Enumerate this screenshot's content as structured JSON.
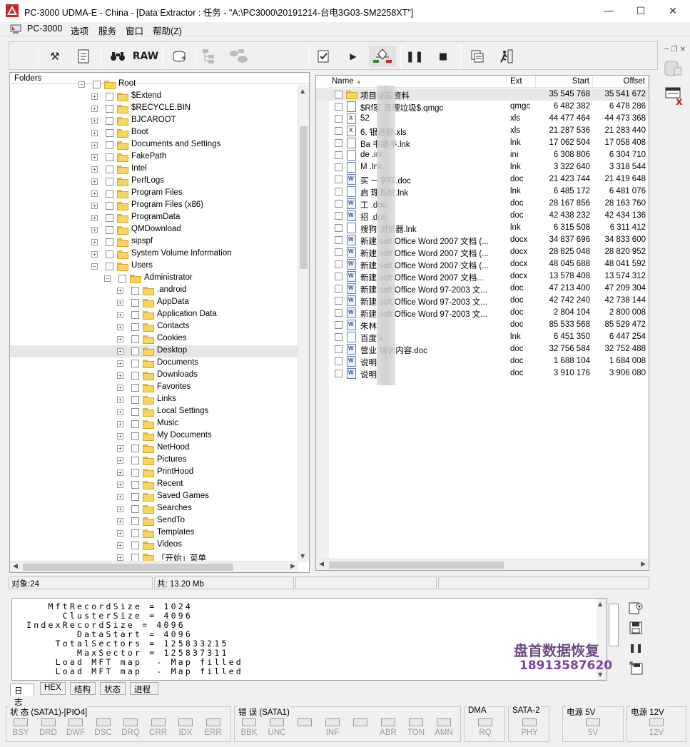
{
  "window": {
    "title": "PC-3000 UDMA-E - China - [Data Extractor : 任务 - \"A:\\PC3000\\20191214-台电3G03-SM2258XT\"]",
    "minimize": "—",
    "maximize": "☐",
    "close": "✕"
  },
  "menu": {
    "items": [
      "PC-3000",
      "选项",
      "服务",
      "窗口",
      "帮助(Z)"
    ],
    "mdi": "─ ❐ ✕"
  },
  "toolbar": {
    "raw_label": "RAW"
  },
  "folders": {
    "header": "Folders",
    "rows": [
      {
        "label": "Root",
        "level": 0,
        "exp": "−"
      },
      {
        "label": "$Extend",
        "level": 1,
        "exp": "+"
      },
      {
        "label": "$RECYCLE.BIN",
        "level": 1,
        "exp": "+"
      },
      {
        "label": "BJCAROOT",
        "level": 1,
        "exp": "+"
      },
      {
        "label": "Boot",
        "level": 1,
        "exp": "+"
      },
      {
        "label": "Documents and Settings",
        "level": 1,
        "exp": "+"
      },
      {
        "label": "FakePath",
        "level": 1,
        "exp": "+"
      },
      {
        "label": "Intel",
        "level": 1,
        "exp": "+"
      },
      {
        "label": "PerfLogs",
        "level": 1,
        "exp": "+"
      },
      {
        "label": "Program Files",
        "level": 1,
        "exp": "+"
      },
      {
        "label": "Program Files (x86)",
        "level": 1,
        "exp": "+"
      },
      {
        "label": "ProgramData",
        "level": 1,
        "exp": "+"
      },
      {
        "label": "QMDownload",
        "level": 1,
        "exp": "+"
      },
      {
        "label": "sipspf",
        "level": 1,
        "exp": "+"
      },
      {
        "label": "System Volume Information",
        "level": 1,
        "exp": "+"
      },
      {
        "label": "Users",
        "level": 1,
        "exp": "−"
      },
      {
        "label": "Administrator",
        "level": 2,
        "exp": "−"
      },
      {
        "label": ".android",
        "level": 3,
        "exp": "+"
      },
      {
        "label": "AppData",
        "level": 3,
        "exp": "+"
      },
      {
        "label": "Application Data",
        "level": 3,
        "exp": "+"
      },
      {
        "label": "Contacts",
        "level": 3,
        "exp": "+"
      },
      {
        "label": "Cookies",
        "level": 3,
        "exp": "+"
      },
      {
        "label": "Desktop",
        "level": 3,
        "exp": "+",
        "selected": true
      },
      {
        "label": "Documents",
        "level": 3,
        "exp": "+"
      },
      {
        "label": "Downloads",
        "level": 3,
        "exp": "+"
      },
      {
        "label": "Favorites",
        "level": 3,
        "exp": "+"
      },
      {
        "label": "Links",
        "level": 3,
        "exp": "+"
      },
      {
        "label": "Local Settings",
        "level": 3,
        "exp": "+"
      },
      {
        "label": "Music",
        "level": 3,
        "exp": "+"
      },
      {
        "label": "My Documents",
        "level": 3,
        "exp": "+"
      },
      {
        "label": "NetHood",
        "level": 3,
        "exp": "+"
      },
      {
        "label": "Pictures",
        "level": 3,
        "exp": "+"
      },
      {
        "label": "PrintHood",
        "level": 3,
        "exp": "+"
      },
      {
        "label": "Recent",
        "level": 3,
        "exp": "+"
      },
      {
        "label": "Saved Games",
        "level": 3,
        "exp": "+"
      },
      {
        "label": "Searches",
        "level": 3,
        "exp": "+"
      },
      {
        "label": "SendTo",
        "level": 3,
        "exp": "+"
      },
      {
        "label": "Templates",
        "level": 3,
        "exp": "+"
      },
      {
        "label": "Videos",
        "level": 3,
        "exp": "+"
      },
      {
        "label": "「开始」菜单",
        "level": 3,
        "exp": "+"
      }
    ]
  },
  "files": {
    "columns": {
      "name": "Name",
      "ext": "Ext",
      "start": "Start",
      "offset": "Offset"
    },
    "rows": [
      {
        "name": "项目全国资料",
        "ext": "",
        "start": "35 545 768",
        "offset": "35 541 672",
        "icon": "folder",
        "hl": true
      },
      {
        "name": "$Rf家 清理垃圾$.qmgc",
        "ext": "qmgc",
        "start": "6 482 382",
        "offset": "6 478 286",
        "icon": "file"
      },
      {
        "name": "52",
        "ext": "xls",
        "start": "44 477 464",
        "offset": "44 473 368",
        "icon": "xls"
      },
      {
        "name": "6, 银总额.xls",
        "ext": "xls",
        "start": "21 287 536",
        "offset": "21 283 440",
        "icon": "xls"
      },
      {
        "name": "Ba 书助手.lnk",
        "ext": "lnk",
        "start": "17 062 504",
        "offset": "17 058 408",
        "icon": "file"
      },
      {
        "name": "de .ini",
        "ext": "ini",
        "start": "6 308 806",
        "offset": "6 304 710",
        "icon": "file"
      },
      {
        "name": "M .lnk",
        "ext": "lnk",
        "start": "3 322 640",
        "offset": "3 318 544",
        "icon": "file"
      },
      {
        "name": "买 一字样.doc",
        "ext": "doc",
        "start": "21 423 744",
        "offset": "21 419 648",
        "icon": "doc"
      },
      {
        "name": "启 理系统.lnk",
        "ext": "lnk",
        "start": "6 485 172",
        "offset": "6 481 076",
        "icon": "file"
      },
      {
        "name": "工 .doc",
        "ext": "doc",
        "start": "28 167 856",
        "offset": "28 163 760",
        "icon": "doc"
      },
      {
        "name": "招 .doc",
        "ext": "doc",
        "start": "42 438 232",
        "offset": "42 434 136",
        "icon": "doc"
      },
      {
        "name": "搜狗 浏览器.lnk",
        "ext": "lnk",
        "start": "6 315 508",
        "offset": "6 311 412",
        "icon": "file"
      },
      {
        "name": "新建 soft Office Word 2007 文档 (...",
        "ext": "docx",
        "start": "34 837 696",
        "offset": "34 833 600",
        "icon": "doc"
      },
      {
        "name": "新建 soft Office Word 2007 文档 (...",
        "ext": "docx",
        "start": "28 825 048",
        "offset": "28 820 952",
        "icon": "doc"
      },
      {
        "name": "新建 soft Office Word 2007 文档 (...",
        "ext": "docx",
        "start": "48 045 688",
        "offset": "48 041 592",
        "icon": "doc"
      },
      {
        "name": "新建 soft Office Word 2007 文档...",
        "ext": "docx",
        "start": "13 578 408",
        "offset": "13 574 312",
        "icon": "doc"
      },
      {
        "name": "新建 soft Office Word 97-2003 文...",
        "ext": "doc",
        "start": "47 213 400",
        "offset": "47 209 304",
        "icon": "doc"
      },
      {
        "name": "新建 soft Office Word 97-2003 文...",
        "ext": "doc",
        "start": "42 742 240",
        "offset": "42 738 144",
        "icon": "doc"
      },
      {
        "name": "新建 soft Office Word 97-2003 文...",
        "ext": "doc",
        "start": "2 804 104",
        "offset": "2 800 008",
        "icon": "doc"
      },
      {
        "name": "朱林",
        "ext": "doc",
        "start": "85 533 568",
        "offset": "85 529 472",
        "icon": "doc"
      },
      {
        "name": "百度 k",
        "ext": "lnk",
        "start": "6 451 350",
        "offset": "6 447 254",
        "icon": "file"
      },
      {
        "name": "营业 培训内容.doc",
        "ext": "doc",
        "start": "32 756 584",
        "offset": "32 752 488",
        "icon": "doc"
      },
      {
        "name": "说明",
        "ext": "doc",
        "start": "1 688 104",
        "offset": "1 684 008",
        "icon": "doc"
      },
      {
        "name": "说明",
        "ext": "doc",
        "start": "3 910 176",
        "offset": "3 906 080",
        "icon": "doc"
      }
    ]
  },
  "status": {
    "objects": "对象:24",
    "total": "共: 13.20 Mb"
  },
  "log": {
    "lines": [
      "    MftRecordSize = 1024",
      "      ClusterSize = 4096",
      " IndexRecordSize = 4096",
      "        DataStart = 4096",
      "     TotalSectors = 125833215",
      "        MaxSector = 125837311",
      "     Load MFT map  - Map filled",
      "     Load MFT map  - Map filled"
    ],
    "tabs": [
      "日志",
      "HEX",
      "结构",
      "状态",
      "进程"
    ]
  },
  "watermark": {
    "name": "盘首数据恢复",
    "phone": "18913587620"
  },
  "bottom": {
    "status_title": "状 态 (SATA1)-[PIO4]",
    "status_leds": [
      "BSY",
      "DRD",
      "DWF",
      "DSC",
      "DRQ",
      "CRR",
      "IDX",
      "ERR"
    ],
    "error_title": "错 误 (SATA1)",
    "error_leds": [
      "BBK",
      "UNC",
      "",
      "INF",
      "",
      "ABR",
      "TON",
      "AMN"
    ],
    "dma_title": "DMA",
    "dma_leds": [
      "RQ"
    ],
    "sata_title": "SATA-2",
    "sata_leds": [
      "PHY"
    ],
    "p5_title": "电源 5V",
    "p5_leds": [
      "5V"
    ],
    "p12_title": "电源 12V",
    "p12_leds": [
      "12V"
    ]
  }
}
